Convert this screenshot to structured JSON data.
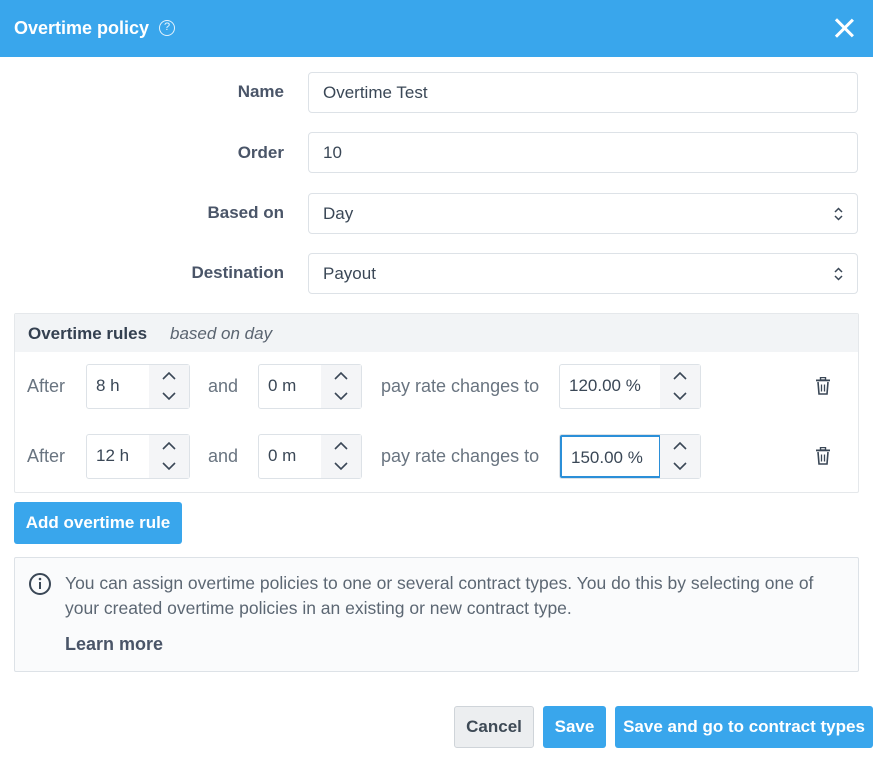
{
  "header": {
    "title": "Overtime policy",
    "help_icon": "?"
  },
  "form": {
    "name_label": "Name",
    "name_value": "Overtime Test",
    "order_label": "Order",
    "order_value": "10",
    "based_on_label": "Based on",
    "based_on_value": "Day",
    "destination_label": "Destination",
    "destination_value": "Payout"
  },
  "rules": {
    "title": "Overtime rules",
    "subtitle": "based on day",
    "after_label": "After",
    "and_label": "and",
    "changes_label": "pay rate changes to",
    "items": [
      {
        "hours": "8 h",
        "minutes": "0 m",
        "rate": "120.00 %"
      },
      {
        "hours": "12 h",
        "minutes": "0 m",
        "rate": "150.00 %"
      }
    ],
    "add_button": "Add overtime rule"
  },
  "info": {
    "message": "You can assign overtime policies to one or several contract types. You do this by selecting one of your created overtime policies in an existing or new contract type.",
    "learn_more": "Learn more"
  },
  "footer": {
    "cancel": "Cancel",
    "save": "Save",
    "save_and_go": "Save and go to contract types"
  },
  "colors": {
    "accent": "#39a6ec",
    "text": "#4a5568"
  }
}
